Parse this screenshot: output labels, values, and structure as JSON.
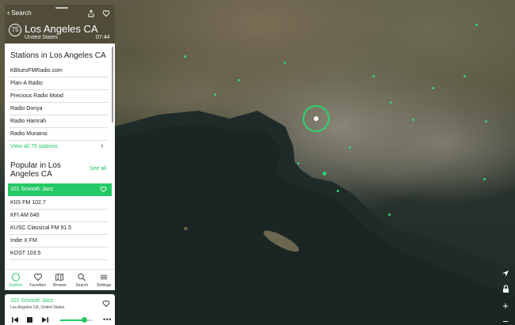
{
  "header": {
    "back_label": "Search",
    "station_count": "75",
    "city": "Los Angeles CA",
    "country": "United States",
    "local_time": "07:44"
  },
  "stations": {
    "title": "Stations in Los Angeles CA",
    "items": [
      {
        "label": "KBluesFMRadio.com"
      },
      {
        "label": "Plan-A Radio"
      },
      {
        "label": "Precious Radio Mood"
      },
      {
        "label": "Radio Donya"
      },
      {
        "label": "Radio Hamrah"
      },
      {
        "label": "Radio Munansi"
      }
    ],
    "view_all_label": "View all 75 stations"
  },
  "popular": {
    "title_line1": "Popular in Los",
    "title_line2": "Angeles CA",
    "see_all_label": "See all",
    "items": [
      {
        "label": "101 Smooth Jazz",
        "active": true
      },
      {
        "label": "KIIS FM 102.7"
      },
      {
        "label": "KFI AM 640"
      },
      {
        "label": "KUSC Classical FM 91.5"
      },
      {
        "label": "Indie X FM"
      },
      {
        "label": "KOST 103.5"
      }
    ]
  },
  "tabs": [
    {
      "label": "Explore",
      "icon": "explore-icon",
      "active": true
    },
    {
      "label": "Favorites",
      "icon": "heart-icon"
    },
    {
      "label": "Browse",
      "icon": "map-icon"
    },
    {
      "label": "Search",
      "icon": "search-icon"
    },
    {
      "label": "Settings",
      "icon": "menu-icon"
    }
  ],
  "player": {
    "title": "101 Smooth Jazz",
    "subtitle": "Los Angeles CA, United States",
    "volume": 0.75
  },
  "colors": {
    "accent": "#25c866",
    "marker": "#2bd56f"
  }
}
